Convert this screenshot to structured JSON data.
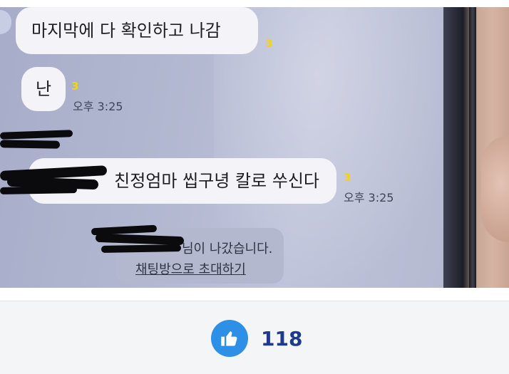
{
  "chat": {
    "message_1": "마지막에 다 확인하고 나감",
    "message_1_unread": "3",
    "message_2": "난",
    "message_2_unread": "3",
    "message_2_time": "오후 3:25",
    "message_3": "친정엄마 씹구녕 칼로 쑤신다",
    "message_3_unread": "3",
    "message_3_time": "오후 3:25",
    "notice_text": "님이 나갔습니다.",
    "invite_link": "채팅방으로 초대하기"
  },
  "likes": {
    "icon": "thumbs-up-icon",
    "count": "118",
    "accent_color": "#2e8fe6",
    "count_color": "#1e3a8a"
  }
}
